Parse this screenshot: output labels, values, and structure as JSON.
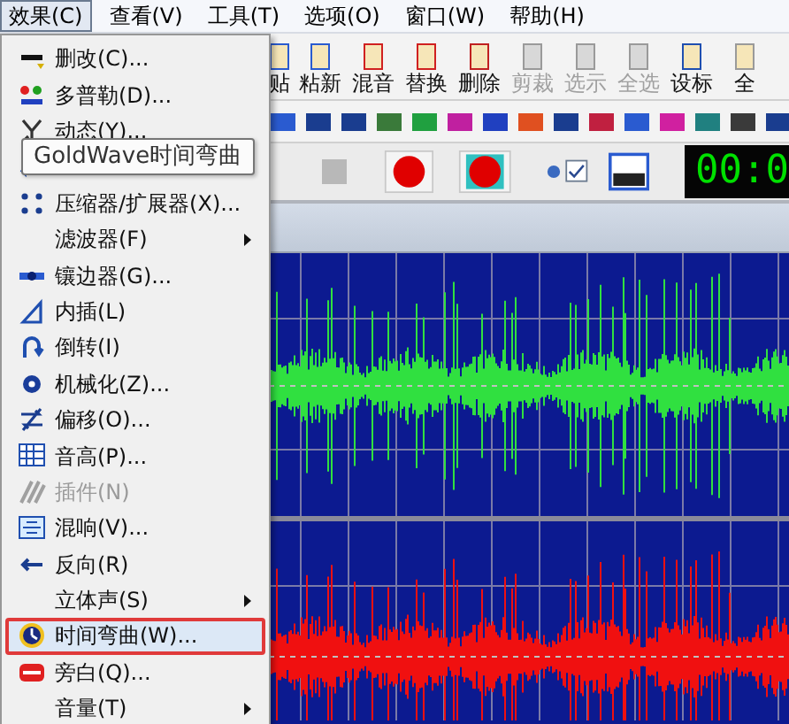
{
  "menu_bar": [
    {
      "label": "效果(C)",
      "selected": true
    },
    {
      "label": "查看(V)",
      "selected": false
    },
    {
      "label": "工具(T)",
      "selected": false
    },
    {
      "label": "选项(O)",
      "selected": false
    },
    {
      "label": "窗口(W)",
      "selected": false
    },
    {
      "label": "帮助(H)",
      "selected": false
    }
  ],
  "toolbar": {
    "buttons": [
      {
        "label": "贴",
        "disabled": false
      },
      {
        "label": "粘新",
        "disabled": false
      },
      {
        "label": "混音",
        "disabled": false
      },
      {
        "label": "替换",
        "disabled": false
      },
      {
        "label": "删除",
        "disabled": false
      },
      {
        "label": "剪裁",
        "disabled": true
      },
      {
        "label": "选示",
        "disabled": true
      },
      {
        "label": "全选",
        "disabled": true
      },
      {
        "label": "设标",
        "disabled": false
      },
      {
        "label": "全",
        "disabled": false
      }
    ]
  },
  "time_display": "00:0",
  "effects_menu": {
    "items": [
      {
        "label": "删改(C)...",
        "disabled": false,
        "submenu": false,
        "selected": false
      },
      {
        "label": "多普勒(D)...",
        "disabled": false,
        "submenu": false,
        "selected": false
      },
      {
        "label": "动态(Y)...",
        "disabled": false,
        "submenu": false,
        "selected": false
      },
      {
        "selected": false
      },
      {
        "label": "压缩器/扩展器(X)...",
        "disabled": false,
        "submenu": false,
        "selected": false
      },
      {
        "label": "滤波器(F)",
        "disabled": false,
        "submenu": true,
        "selected": false
      },
      {
        "label": "镶边器(G)...",
        "disabled": false,
        "submenu": false,
        "selected": false
      },
      {
        "label": "内插(L)",
        "disabled": false,
        "submenu": false,
        "selected": false
      },
      {
        "label": "倒转(I)",
        "disabled": false,
        "submenu": false,
        "selected": false
      },
      {
        "label": "机械化(Z)...",
        "disabled": false,
        "submenu": false,
        "selected": false
      },
      {
        "label": "偏移(O)...",
        "disabled": false,
        "submenu": false,
        "selected": false
      },
      {
        "label": "音高(P)...",
        "disabled": false,
        "submenu": false,
        "selected": false
      },
      {
        "label": "插件(N)",
        "disabled": true,
        "submenu": false,
        "selected": false
      },
      {
        "label": "混响(V)...",
        "disabled": false,
        "submenu": false,
        "selected": false
      },
      {
        "label": "反向(R)",
        "disabled": false,
        "submenu": false,
        "selected": false
      },
      {
        "label": "立体声(S)",
        "disabled": false,
        "submenu": true,
        "selected": false
      },
      {
        "label": "时间弯曲(W)...",
        "disabled": false,
        "submenu": false,
        "selected": true
      },
      {
        "label": "旁白(Q)...",
        "disabled": false,
        "submenu": false,
        "selected": false
      },
      {
        "label": "音量(T)",
        "disabled": false,
        "submenu": true,
        "selected": false
      }
    ]
  },
  "tooltip": "GoldWave时间弯曲"
}
